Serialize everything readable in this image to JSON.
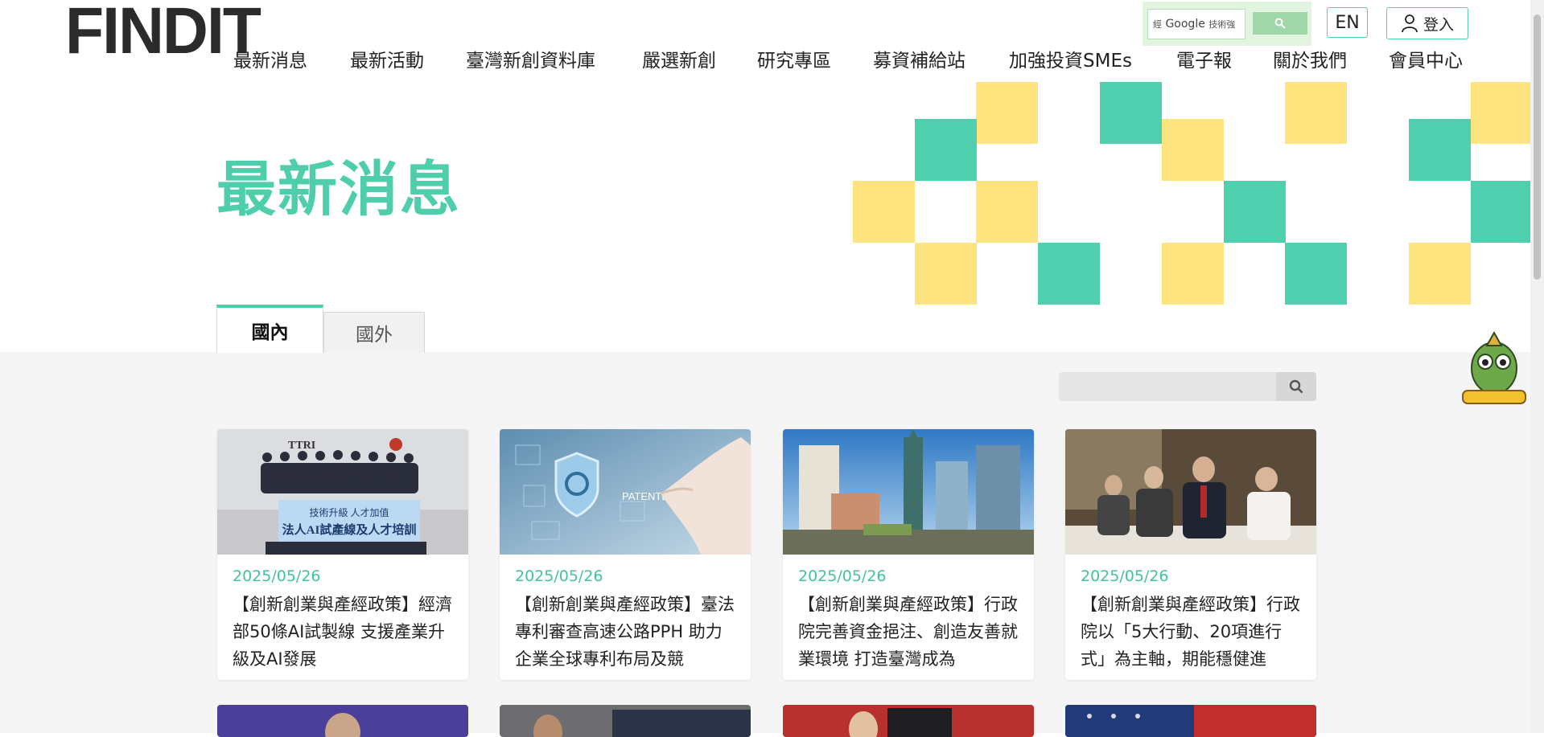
{
  "header": {
    "logo": "FINDIT",
    "search": {
      "prefix": "經",
      "brand": "Google",
      "suffix": "技術強"
    },
    "lang_label": "EN",
    "login_label": "登入"
  },
  "nav": [
    "最新消息",
    "最新活動",
    "臺灣新創資料庫",
    "嚴選新創",
    "研究專區",
    "募資補給站",
    "加強投資SMEs",
    "電子報",
    "關於我們",
    "會員中心"
  ],
  "hero": {
    "title": "最新消息"
  },
  "tabs": [
    {
      "label": "國內",
      "active": true
    },
    {
      "label": "國外",
      "active": false
    }
  ],
  "list_search": {
    "placeholder": ""
  },
  "cards": [
    {
      "date": "2025/05/26",
      "title": "【創新創業與產經政策】經濟部50條AI試製線 支援產業升級及AI發展"
    },
    {
      "date": "2025/05/26",
      "title": "【創新創業與產經政策】臺法專利審查高速公路PPH 助力企業全球專利布局及競"
    },
    {
      "date": "2025/05/26",
      "title": "【創新創業與產經政策】行政院完善資金挹注、創造友善就業環境 打造臺灣成為"
    },
    {
      "date": "2025/05/26",
      "title": "【創新創業與產經政策】行政院以「5大行動、20項進行式」為主軸，期能穩健進"
    }
  ],
  "card1_banner": {
    "org": "TTRI",
    "line1": "技術升級 人才加值",
    "line2": "法人AI試產線及人才培訓"
  },
  "card2_label": "PATENTED",
  "colors": {
    "accent": "#4fceac",
    "yellow": "#fde47f",
    "date": "#3fc49f"
  }
}
